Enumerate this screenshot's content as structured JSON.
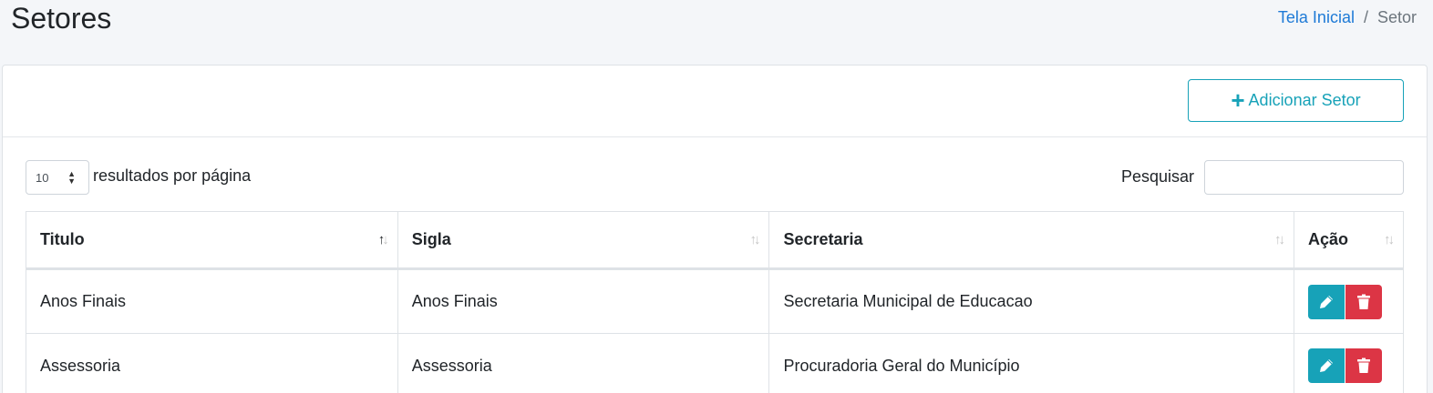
{
  "header": {
    "title": "Setores",
    "breadcrumb": {
      "home": "Tela Inicial",
      "separator": "/",
      "current": "Setor"
    }
  },
  "toolbar": {
    "add_label": "Adicionar Setor",
    "add_icon": "plus-icon"
  },
  "table_controls": {
    "page_length_value": "10",
    "page_length_label": "resultados por página",
    "search_label": "Pesquisar",
    "search_value": ""
  },
  "table": {
    "columns": [
      "Titulo",
      "Sigla",
      "Secretaria",
      "Ação"
    ],
    "sorted_column": "Titulo",
    "rows": [
      {
        "titulo": "Anos Finais",
        "sigla": "Anos Finais",
        "secretaria": "Secretaria Municipal de Educacao"
      },
      {
        "titulo": "Assessoria",
        "sigla": "Assessoria",
        "secretaria": "Procuradoria Geral do Município"
      }
    ],
    "action_icons": [
      "pencil-icon",
      "trash-icon"
    ]
  },
  "colors": {
    "accent": "#17a2b8",
    "danger": "#dc3545",
    "link": "#1e7ad6",
    "background": "#f4f6f9"
  }
}
